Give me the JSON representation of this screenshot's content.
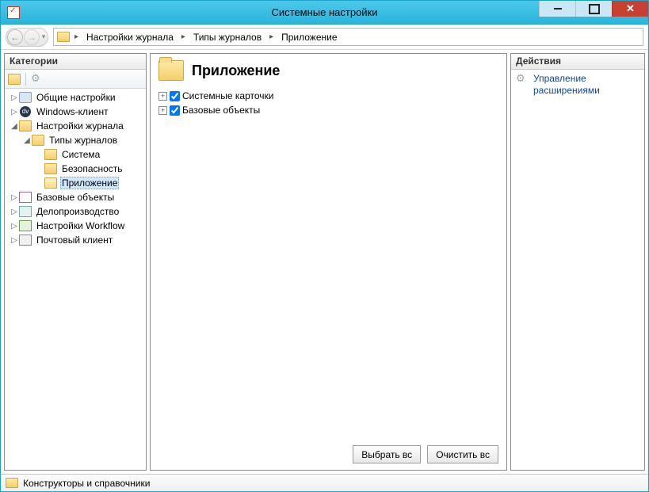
{
  "window": {
    "title": "Системные настройки"
  },
  "breadcrumbs": {
    "c1": "Настройки журнала",
    "c2": "Типы журналов",
    "c3": "Приложение"
  },
  "left": {
    "header": "Категории",
    "nodes": {
      "general": "Общие настройки",
      "winclient": "Windows-клиент",
      "logset": "Настройки журнала",
      "logtypes": "Типы журналов",
      "system": "Система",
      "security": "Безопасность",
      "app": "Приложение",
      "baseobj": "Базовые объекты",
      "paperwork": "Делопроизводство",
      "workflow": "Настройки Workflow",
      "mail": "Почтовый клиент"
    }
  },
  "center": {
    "title": "Приложение",
    "items": {
      "0": "Системные карточки",
      "1": "Базовые объекты"
    },
    "buttons": {
      "select_all": "Выбрать вс",
      "clear_all": "Очистить вс"
    }
  },
  "right": {
    "header": "Действия",
    "links": {
      "manage_ext": "Управление расширениями"
    }
  },
  "status": {
    "text": "Конструкторы и справочники"
  }
}
